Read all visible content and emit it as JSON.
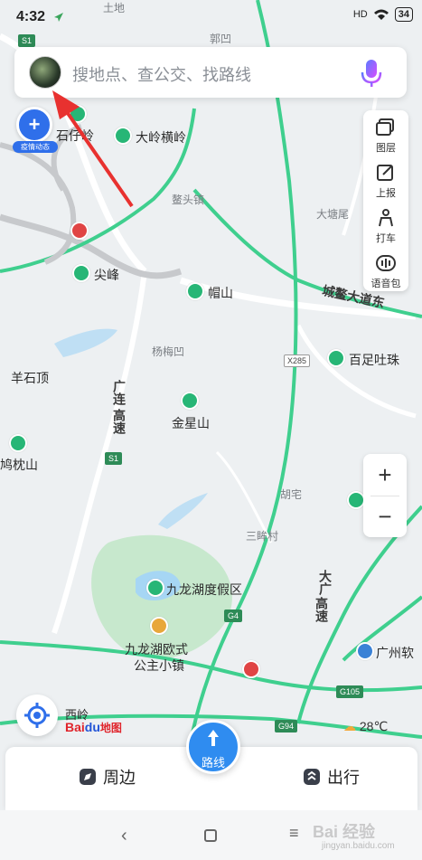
{
  "status": {
    "time": "4:32",
    "battery": "34",
    "signal": "HD"
  },
  "search": {
    "placeholder": "搜地点、查公交、找路线"
  },
  "epidemic": {
    "label": "疫情动态"
  },
  "tools": [
    {
      "icon": "layers-icon",
      "label": "图层"
    },
    {
      "icon": "report-icon",
      "label": "上报"
    },
    {
      "icon": "taxi-icon",
      "label": "打车"
    },
    {
      "icon": "voice-pack-icon",
      "label": "语音包"
    }
  ],
  "zoom": {
    "in": "+",
    "out": "−"
  },
  "map_labels": {
    "tudi": "土地",
    "guowu": "郭凹",
    "shizaling": "石仔岭",
    "dalinghengling": "大岭横岭",
    "aotouzhen": "鳌头镇",
    "datanwei": "大塘尾",
    "jianfeng": "尖峰",
    "maoshan": "帽山",
    "chengao": "城鳌大道东",
    "yangmeiao": "杨梅凹",
    "baizutuzhu": "百足吐珠",
    "yangshiding": "羊石顶",
    "guanglian": "广连",
    "gaosu": "高速",
    "jinxingshan": "金星山",
    "zhenshan": "鸠枕山",
    "huzhai": "胡宅",
    "sanmoucun": "三眸村",
    "jiulong": "九龙湖度假区",
    "jiulong_town": "九龙湖欧式",
    "jiulong_town2": "公主小镇",
    "dagao": "大广",
    "gaosu2": "高速",
    "guangzhou_soft": "广州软",
    "xiling": "西岭",
    "da": "大",
    "x285": "X285",
    "s1": "S1",
    "s1b": "S1",
    "g4": "G4",
    "g105": "G105",
    "g94": "G94"
  },
  "brand": {
    "logo_part1": "Bai",
    "logo_part2": "du",
    "logo_part3": "地图"
  },
  "weather": {
    "temp": "28℃"
  },
  "bottom": {
    "nearby": "周边",
    "route": "路线",
    "trip": "出行"
  },
  "watermark": {
    "main": "Bai 经验",
    "sub": "jingyan.baidu.com"
  },
  "colors": {
    "accent": "#2f8cf0",
    "road": "#3fcf8e",
    "poi": "#27b676",
    "arrow": "#e8312f"
  }
}
